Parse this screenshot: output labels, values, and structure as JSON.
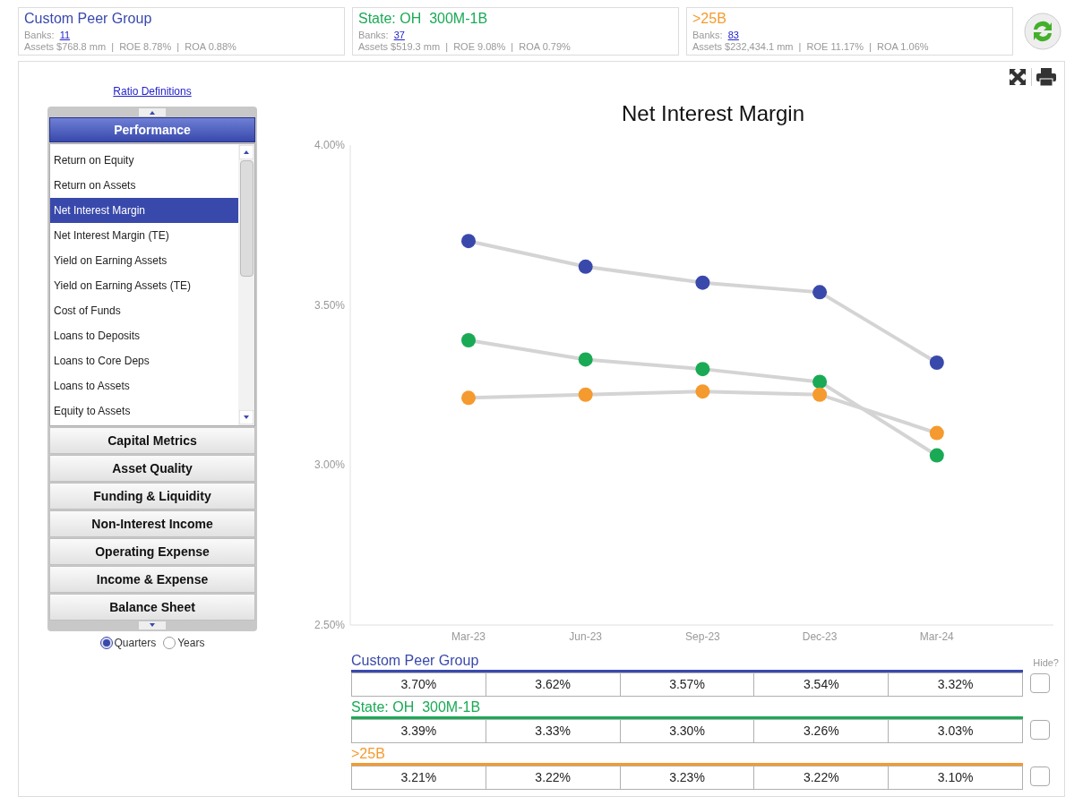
{
  "header": {
    "groups": [
      {
        "name": "Custom Peer Group",
        "color": "#3949ab",
        "banks_label": "Banks:",
        "banks_count": "11",
        "stats": "Assets $768.8 mm  |  ROE 8.78%  |  ROA 0.88%"
      },
      {
        "name": "State: OH  300M-1B",
        "color": "#1aaa55",
        "banks_label": "Banks:",
        "banks_count": "37",
        "stats": "Assets $519.3 mm  |  ROE 9.08%  |  ROA 0.79%"
      },
      {
        "name": ">25B",
        "color": "#f59a2e",
        "banks_label": "Banks:",
        "banks_count": "83",
        "stats": "Assets $232,434.1 mm  |  ROE 11.17%  |  ROA 1.06%"
      }
    ]
  },
  "sidebar": {
    "link": "Ratio Definitions",
    "sections": [
      {
        "label": "Performance",
        "expanded": true,
        "items": [
          {
            "label": "Return on Equity",
            "selected": false
          },
          {
            "label": "Return on Assets",
            "selected": false
          },
          {
            "label": "Net Interest Margin",
            "selected": true
          },
          {
            "label": "Net Interest Margin (TE)",
            "selected": false
          },
          {
            "label": "Yield on Earning Assets",
            "selected": false
          },
          {
            "label": "Yield on Earning Assets (TE)",
            "selected": false
          },
          {
            "label": "Cost of Funds",
            "selected": false
          },
          {
            "label": "Loans to Deposits",
            "selected": false
          },
          {
            "label": "Loans to Core Deps",
            "selected": false
          },
          {
            "label": "Loans to Assets",
            "selected": false
          },
          {
            "label": "Equity to Assets",
            "selected": false
          }
        ]
      },
      {
        "label": "Capital Metrics",
        "expanded": false
      },
      {
        "label": "Asset Quality",
        "expanded": false
      },
      {
        "label": "Funding & Liquidity",
        "expanded": false
      },
      {
        "label": "Non-Interest Income",
        "expanded": false
      },
      {
        "label": "Operating Expense",
        "expanded": false
      },
      {
        "label": "Income & Expense",
        "expanded": false
      },
      {
        "label": "Balance Sheet",
        "expanded": false
      }
    ],
    "period_options": [
      {
        "label": "Quarters",
        "selected": true
      },
      {
        "label": "Years",
        "selected": false
      }
    ]
  },
  "chart": {
    "title": "Net Interest Margin",
    "chart_data": {
      "type": "line",
      "categories": [
        "Mar-23",
        "Jun-23",
        "Sep-23",
        "Dec-23",
        "Mar-24"
      ],
      "ylim": [
        2.5,
        4.0
      ],
      "yticks": [
        {
          "value": 2.5,
          "label": "2.50%"
        },
        {
          "value": 3.0,
          "label": "3.00%"
        },
        {
          "value": 3.5,
          "label": "3.50%"
        },
        {
          "value": 4.0,
          "label": "4.00%"
        }
      ],
      "series": [
        {
          "name": "Custom Peer Group",
          "color": "#3949ab",
          "marker": "circle",
          "values": [
            3.7,
            3.62,
            3.57,
            3.54,
            3.32
          ]
        },
        {
          "name": "State: OH  300M-1B",
          "color": "#1aaa55",
          "marker": "circle",
          "values": [
            3.39,
            3.33,
            3.3,
            3.26,
            3.03
          ]
        },
        {
          "name": ">25B",
          "color": "#f59a2e",
          "marker": "circle",
          "values": [
            3.21,
            3.22,
            3.23,
            3.22,
            3.1
          ]
        }
      ]
    }
  },
  "table": {
    "hide_label": "Hide?",
    "groups": [
      {
        "hidden": false,
        "values": [
          "3.70%",
          "3.62%",
          "3.57%",
          "3.54%",
          "3.32%"
        ]
      },
      {
        "hidden": false,
        "values": [
          "3.39%",
          "3.33%",
          "3.30%",
          "3.26%",
          "3.03%"
        ]
      },
      {
        "hidden": false,
        "values": [
          "3.21%",
          "3.22%",
          "3.23%",
          "3.22%",
          "3.10%"
        ]
      }
    ]
  }
}
